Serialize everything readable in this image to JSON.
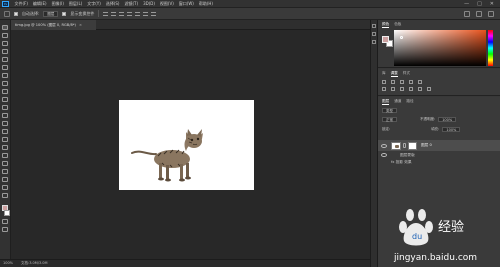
{
  "app": {
    "logo": "Ps"
  },
  "menubar": {
    "items": [
      "文件(F)",
      "编辑(E)",
      "图像(I)",
      "图层(L)",
      "文字(Y)",
      "选择(S)",
      "滤镜(T)",
      "3D(D)",
      "视图(V)",
      "窗口(W)",
      "帮助(H)"
    ],
    "window_controls": [
      "—",
      "□",
      "✕"
    ]
  },
  "options": {
    "auto_select_label": "自动选择:",
    "auto_select_target": "图层",
    "show_transform_label": "显示变换控件"
  },
  "document": {
    "tab_title": "timg.jpg @ 100% (图层 0, RGB/8*)",
    "zoom": "100%",
    "doc_info": "文档:3.0M/3.0M"
  },
  "panels": {
    "color_tabs": [
      "颜色",
      "色板"
    ],
    "adjust_tabs": [
      "库",
      "调整",
      "样式"
    ],
    "layers_tabs": [
      "图层",
      "通道",
      "路径"
    ],
    "kind_label": "类型",
    "blend_mode": "正常",
    "opacity_label": "不透明度:",
    "opacity_value": "100%",
    "lock_label": "锁定:",
    "fill_label": "填充:",
    "fill_value": "100%",
    "layers": [
      {
        "name": "图层 0"
      }
    ],
    "effect_label": "图层蒙版",
    "sub_effect_label": "fx  投影 效果"
  },
  "colors": {
    "foreground": "#cca0a0",
    "background": "#ffffff",
    "accent": "#31a8ff"
  },
  "watermark": {
    "brand": "Baidu",
    "brand_cn": "经验",
    "url": "jingyan.baidu.com"
  }
}
